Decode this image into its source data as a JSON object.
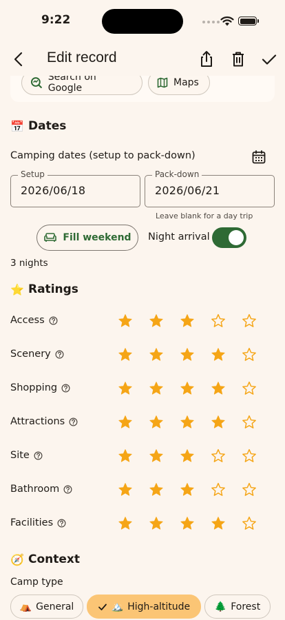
{
  "status": {
    "time": "9:22"
  },
  "header": {
    "title": "Edit record"
  },
  "search": {
    "google_label": "Search on Google",
    "maps_label": "Maps"
  },
  "dates": {
    "emoji": "📅",
    "title": "Dates",
    "camping_label": "Camping dates (setup to pack-down)",
    "setup": {
      "label": "Setup",
      "value": "2026/06/18"
    },
    "packdown": {
      "label": "Pack-down",
      "value": "2026/06/21",
      "helper": "Leave blank for a day trip"
    },
    "fill_weekend_label": "Fill weekend",
    "night_arrival_label": "Night arrival",
    "night_arrival_on": true,
    "nights_text": "3 nights"
  },
  "ratings": {
    "emoji": "⭐",
    "title": "Ratings",
    "max": 5,
    "items": [
      {
        "label": "Access",
        "value": 3
      },
      {
        "label": "Scenery",
        "value": 4
      },
      {
        "label": "Shopping",
        "value": 4
      },
      {
        "label": "Attractions",
        "value": 4
      },
      {
        "label": "Site",
        "value": 3
      },
      {
        "label": "Bathroom",
        "value": 3
      },
      {
        "label": "Facilities",
        "value": 4
      }
    ]
  },
  "context": {
    "emoji": "🧭",
    "title": "Context",
    "camp_type_label": "Camp type",
    "camp_types": [
      {
        "emoji": "⛺",
        "label": "General",
        "selected": false
      },
      {
        "emoji": "🏔️",
        "label": "High-altitude",
        "selected": true
      },
      {
        "emoji": "🌲",
        "label": "Forest",
        "selected": false
      }
    ]
  },
  "colors": {
    "accent": "#2e6a34",
    "star": "#f5a516",
    "chip_selected": "#fbc575",
    "background": "#fcf5ee"
  }
}
